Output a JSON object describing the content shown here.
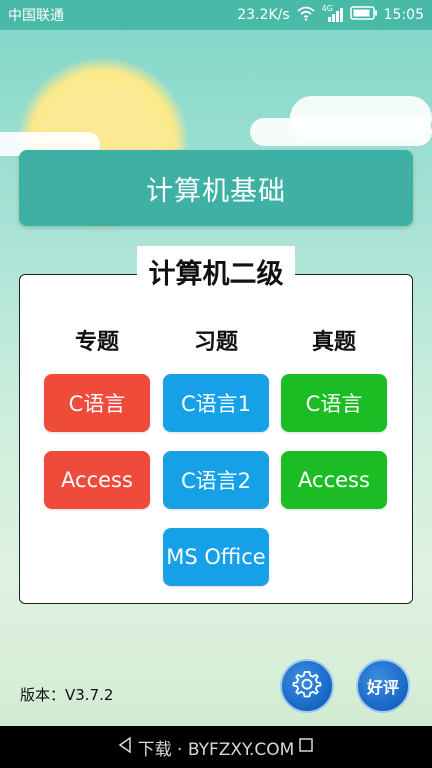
{
  "status_bar": {
    "carrier": "中国联通",
    "net_speed": "23.2K/s",
    "network_type": "4G",
    "time": "15:05"
  },
  "header": {
    "title": "计算机基础"
  },
  "panel": {
    "title": "计算机二级",
    "columns": [
      {
        "heading": "专题",
        "color": "#ef4b3b",
        "buttons": [
          "C语言",
          "Access"
        ]
      },
      {
        "heading": "习题",
        "color": "#16a0e8",
        "buttons": [
          "C语言1",
          "C语言2",
          "MS Office"
        ]
      },
      {
        "heading": "真题",
        "color": "#1cbd24",
        "buttons": [
          "C语言",
          "Access"
        ]
      }
    ]
  },
  "footer": {
    "version": "版本：V3.7.2",
    "settings_icon": "gear-icon",
    "rate_label": "好评"
  },
  "watermark": "下载 · BYFZXY.COM"
}
